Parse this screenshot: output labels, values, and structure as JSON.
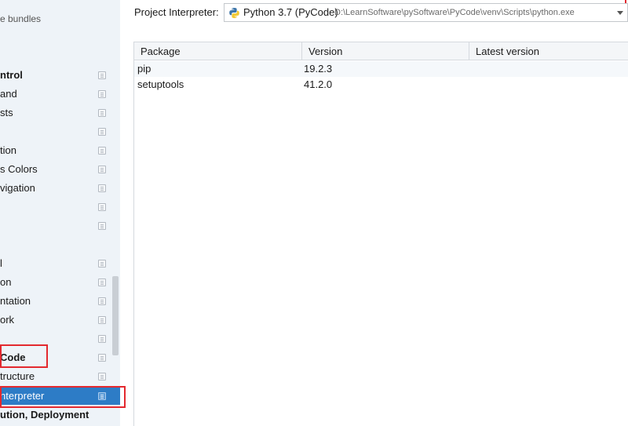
{
  "sidebar": {
    "items": [
      {
        "label": "e bundles",
        "bold": false,
        "icon": ""
      },
      {
        "label": "ntrol",
        "bold": true,
        "icon": "project-scope-icon"
      },
      {
        "label": "and",
        "bold": false,
        "icon": "project-scope-icon"
      },
      {
        "label": "sts",
        "bold": false,
        "icon": "project-scope-icon"
      },
      {
        "label": "",
        "bold": false,
        "icon": "project-scope-icon"
      },
      {
        "label": "tion",
        "bold": false,
        "icon": "project-scope-icon"
      },
      {
        "label": "s Colors",
        "bold": false,
        "icon": "project-scope-icon"
      },
      {
        "label": "vigation",
        "bold": false,
        "icon": "project-scope-icon"
      },
      {
        "label": "",
        "bold": false,
        "icon": "project-scope-icon"
      },
      {
        "label": "",
        "bold": false,
        "icon": "project-scope-icon"
      },
      {
        "label": "l",
        "bold": false,
        "icon": "project-scope-icon"
      },
      {
        "label": "on",
        "bold": false,
        "icon": "project-scope-icon"
      },
      {
        "label": "ntation",
        "bold": false,
        "icon": "project-scope-icon"
      },
      {
        "label": "ork",
        "bold": false,
        "icon": "project-scope-icon"
      },
      {
        "label": "",
        "bold": false,
        "icon": "project-scope-icon"
      },
      {
        "label": "Code",
        "bold": true,
        "icon": "project-scope-icon"
      },
      {
        "label": "tructure",
        "bold": false,
        "icon": "project-scope-icon"
      },
      {
        "label": "nterpreter",
        "bold": false,
        "icon": "project-scope-icon",
        "selected": true
      },
      {
        "label": "ution, Deployment",
        "bold": true,
        "icon": ""
      }
    ]
  },
  "interpreter": {
    "label": "Project Interpreter:",
    "name": "Python 3.7 (PyCode)",
    "path": "D:\\LearnSoftware\\pySoftware\\PyCode\\venv\\Scripts\\python.exe",
    "icon": "python-icon"
  },
  "packages": {
    "columns": [
      "Package",
      "Version",
      "Latest version"
    ],
    "rows": [
      {
        "package": "pip",
        "version": "19.2.3",
        "latest": ""
      },
      {
        "package": "setuptools",
        "version": "41.2.0",
        "latest": ""
      }
    ]
  },
  "colors": {
    "selection": "#2d7cc6",
    "highlight_box": "#e3292f",
    "sidebar_bg": "#eef3f8"
  }
}
